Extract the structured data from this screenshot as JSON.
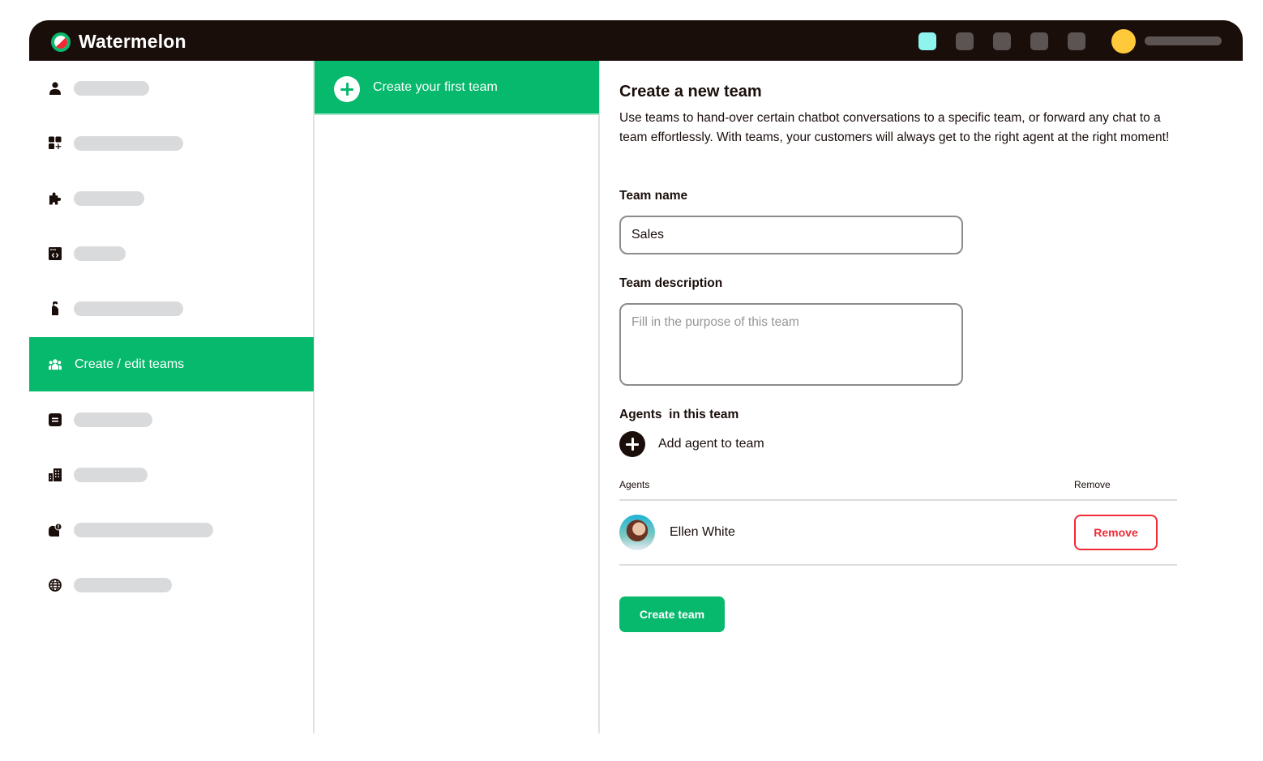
{
  "app": {
    "name": "Watermelon",
    "brand_color": "#07b96c",
    "accent_red": "#f12a36"
  },
  "topbar": {
    "icons": [
      {
        "name": "topbar-app-icon-1",
        "active": true
      },
      {
        "name": "topbar-app-icon-2",
        "active": false
      },
      {
        "name": "topbar-app-icon-3",
        "active": false
      },
      {
        "name": "topbar-app-icon-4",
        "active": false
      },
      {
        "name": "topbar-app-icon-5",
        "active": false
      }
    ],
    "user_avatar_color": "#ffc93a"
  },
  "sidebar": {
    "items": [
      {
        "icon": "user-icon",
        "label": null
      },
      {
        "icon": "add-widget-icon",
        "label": null
      },
      {
        "icon": "puzzle-icon",
        "label": null
      },
      {
        "icon": "code-window-icon",
        "label": null
      },
      {
        "icon": "door-hanger-icon",
        "label": null
      },
      {
        "icon": "team-icon",
        "label": "Create / edit teams",
        "active": true
      },
      {
        "icon": "notes-icon",
        "label": null
      },
      {
        "icon": "building-icon",
        "label": null
      },
      {
        "icon": "notification-badge-icon",
        "label": null
      },
      {
        "icon": "globe-icon",
        "label": null
      }
    ]
  },
  "middle": {
    "create_first_team_label": "Create your first team"
  },
  "form": {
    "title": "Create a new team",
    "description": "Use teams to hand-over certain chatbot conversations to a specific team, or forward any chat to a team effortlessly. With teams, your customers will always get to the right agent at the right moment!",
    "team_name_label": "Team name",
    "team_name_value": "Sales",
    "team_description_label": "Team description",
    "team_description_placeholder": "Fill in the purpose of this team",
    "agents_section_label": "Agents  in this team",
    "add_agent_label": "Add agent to team",
    "table": {
      "col_agents": "Agents",
      "col_remove": "Remove",
      "rows": [
        {
          "name": "Ellen White",
          "remove_label": "Remove"
        }
      ]
    },
    "submit_label": "Create team"
  }
}
